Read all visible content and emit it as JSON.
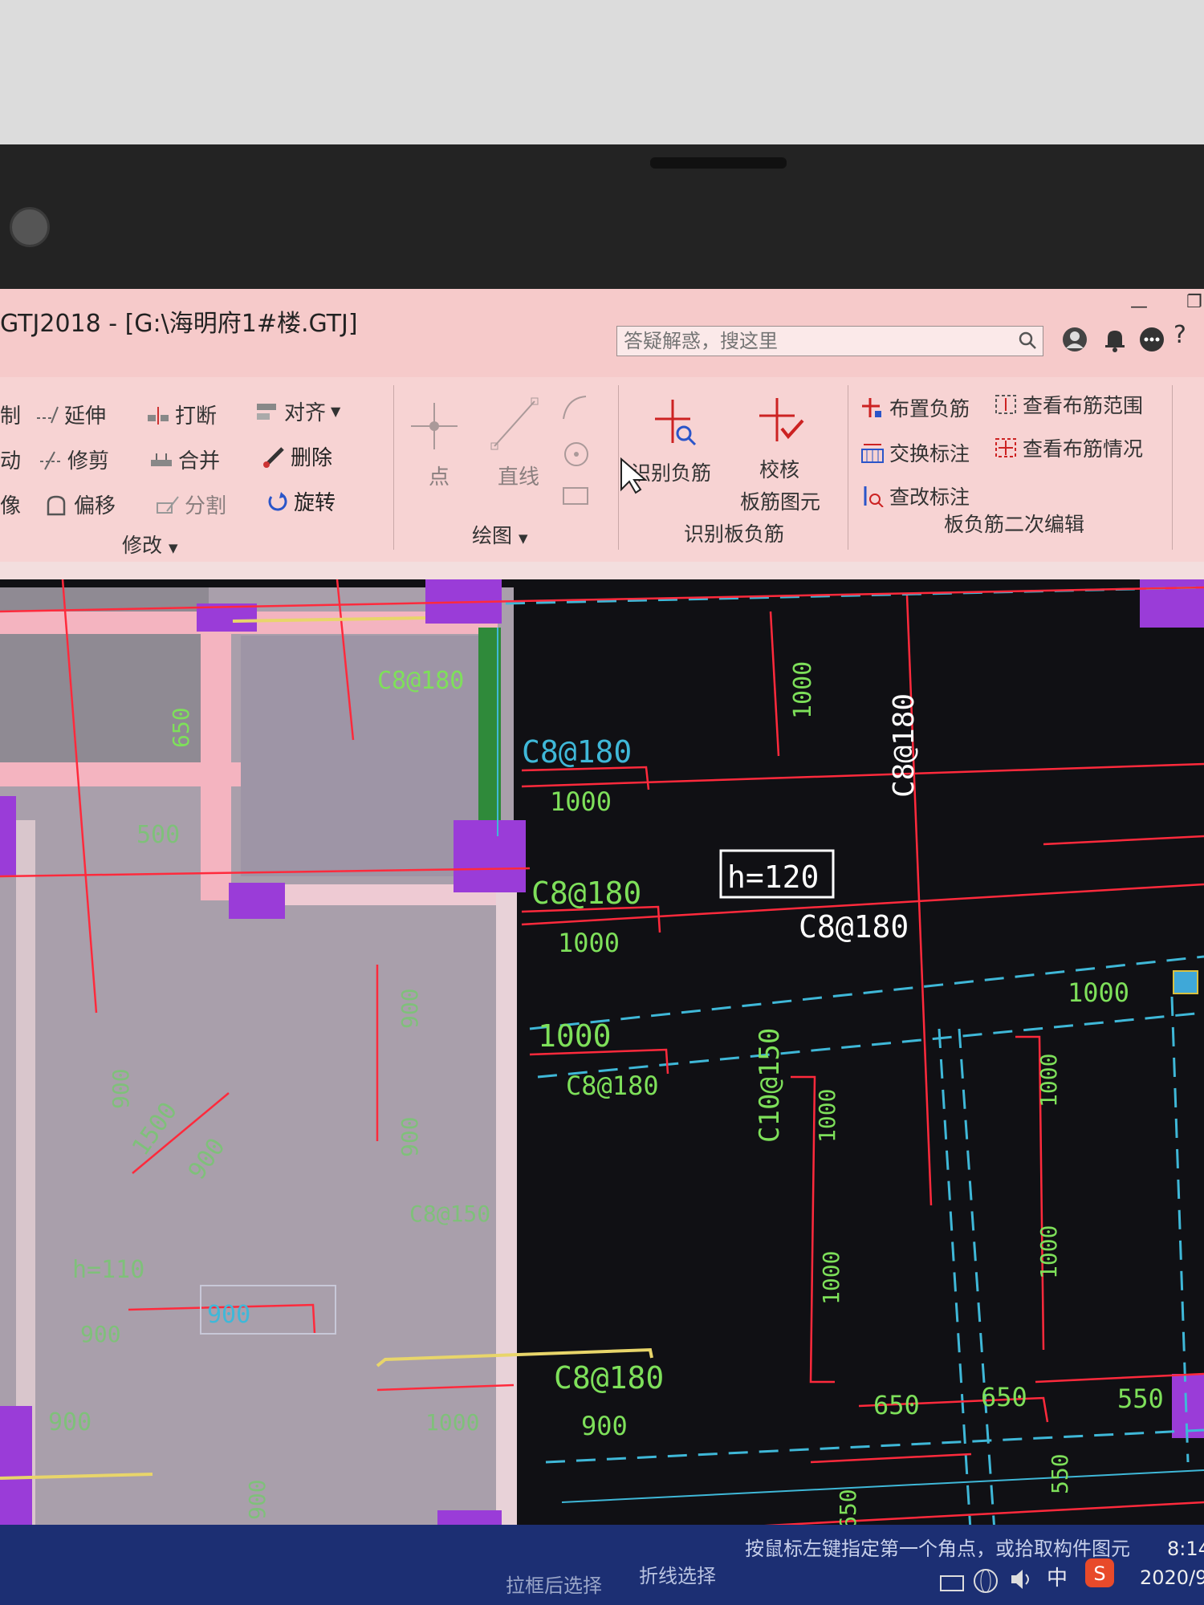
{
  "window": {
    "title": "GTJ2018 - [G:\\海明府1#楼.GTJ]",
    "search_placeholder": "答疑解惑，搜这里",
    "help_label": "?"
  },
  "ribbon": {
    "modify": {
      "items": [
        "制",
        "延伸",
        "打断",
        "对齐",
        "动",
        "修剪",
        "合并",
        "删除",
        "像",
        "偏移",
        "分割",
        "旋转"
      ],
      "group_label": "修改"
    },
    "draw": {
      "items": [
        "点",
        "直线"
      ],
      "group_label": "绘图"
    },
    "identify": {
      "identify_neg_rebar": "识别负筋",
      "check_line1": "校核",
      "check_line2": "板筋图元",
      "group_label": "识别板负筋"
    },
    "secondary": {
      "items": [
        "布置负筋",
        "查看布筋范围",
        "交换标注",
        "查看布筋情况",
        "查改标注"
      ],
      "group_label": "板负筋二次编辑"
    }
  },
  "drawing": {
    "labels": [
      "C8@180",
      "1000",
      "C8@180",
      "1000",
      "h=120",
      "C8@180",
      "C8@180",
      "1000",
      "C8@180",
      "1000",
      "C10@150",
      "1000",
      "1000",
      "1000",
      "1000",
      "C8@180",
      "900",
      "650",
      "650",
      "550",
      "650",
      "550",
      "1000",
      "C8@180",
      "650",
      "500",
      "900",
      "900",
      "900",
      "1500",
      "900",
      "C8@150",
      "900",
      "h=110",
      "900",
      "900",
      "1000",
      "900"
    ]
  },
  "statusbar": {
    "hint": "按鼠标左键指定第一个角点，或拾取构件图元",
    "mode1": "折线选择",
    "mode2": "拉框后选择",
    "ime": "中",
    "time": "8:14",
    "date": "2020/9"
  },
  "colors": {
    "canvas_bg": "#101014",
    "rebar_red": "#ff2a3c",
    "label_green": "#7ee05a",
    "axis_cyan": "#3fb8d8",
    "column_purple": "#9a3cd8"
  }
}
